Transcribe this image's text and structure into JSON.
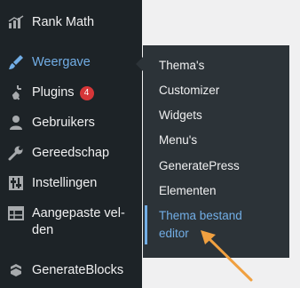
{
  "sidebar": {
    "items": [
      {
        "label": "Rank Math",
        "icon": "bar-chart-icon"
      },
      {
        "label": "Weergave",
        "icon": "paintbrush-icon",
        "active": true
      },
      {
        "label": "Plugins",
        "icon": "plugin-icon",
        "badge": "4"
      },
      {
        "label": "Gebruikers",
        "icon": "user-icon"
      },
      {
        "label": "Gereedschap",
        "icon": "wrench-icon"
      },
      {
        "label": "Instellingen",
        "icon": "sliders-icon"
      },
      {
        "label": "Aangepaste vel-den",
        "icon": "table-icon"
      },
      {
        "label": "GenerateBlocks",
        "icon": "generateblocks-icon"
      }
    ]
  },
  "submenu": {
    "items": [
      {
        "label": "Thema's"
      },
      {
        "label": "Customizer"
      },
      {
        "label": "Widgets"
      },
      {
        "label": "Menu's"
      },
      {
        "label": "GeneratePress"
      },
      {
        "label": "Elementen"
      },
      {
        "label": "Thema bestand editor",
        "current": true
      }
    ]
  },
  "colors": {
    "sidebar_bg": "#1d2327",
    "submenu_bg": "#2c3338",
    "accent": "#72aee6",
    "badge": "#d63638",
    "arrow": "#f0a040"
  }
}
